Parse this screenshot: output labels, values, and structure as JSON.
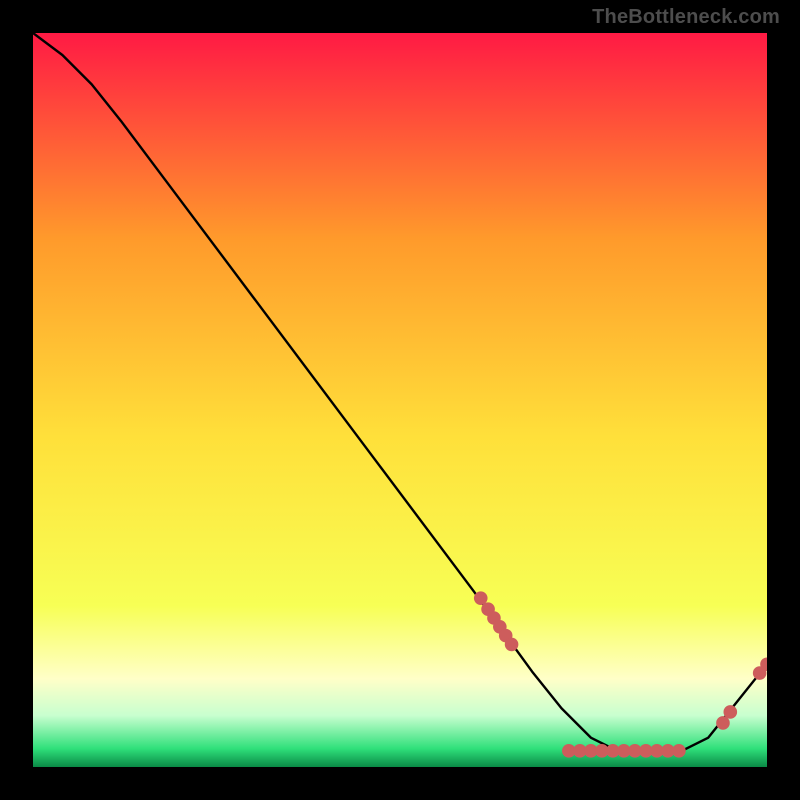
{
  "watermark": "TheBottleneck.com",
  "colors": {
    "frame": "#000000",
    "line": "#000000",
    "point": "#cd5d5c",
    "gradient_top": "#ff1a44",
    "gradient_upper_mid": "#ff9a2b",
    "gradient_mid": "#ffe03a",
    "gradient_lower_mid": "#f7ff55",
    "gradient_yellowwhite": "#ffffc8",
    "gradient_pale": "#c8ffcf",
    "gradient_green": "#2fe07a",
    "gradient_dark_green": "#0a8a46"
  },
  "chart_data": {
    "type": "line",
    "title": "",
    "xlabel": "",
    "ylabel": "",
    "xlim": [
      0,
      100
    ],
    "ylim": [
      0,
      100
    ],
    "grid": false,
    "legend": false,
    "series": [
      {
        "name": "curve",
        "x": [
          0,
          4,
          8,
          12,
          18,
          30,
          45,
          60,
          68,
          72,
          76,
          80,
          84,
          88,
          92,
          96,
          100
        ],
        "y": [
          100,
          97,
          93,
          88,
          80,
          64,
          44,
          24,
          13,
          8,
          4,
          2,
          2,
          2,
          4,
          9,
          14
        ]
      }
    ],
    "scatter_points": [
      {
        "x": 61,
        "y": 23.0
      },
      {
        "x": 62,
        "y": 21.5
      },
      {
        "x": 62.8,
        "y": 20.3
      },
      {
        "x": 63.6,
        "y": 19.1
      },
      {
        "x": 64.4,
        "y": 17.9
      },
      {
        "x": 65.2,
        "y": 16.7
      },
      {
        "x": 73,
        "y": 2.2
      },
      {
        "x": 74.5,
        "y": 2.2
      },
      {
        "x": 76,
        "y": 2.2
      },
      {
        "x": 77.5,
        "y": 2.2
      },
      {
        "x": 79,
        "y": 2.2
      },
      {
        "x": 80.5,
        "y": 2.2
      },
      {
        "x": 82,
        "y": 2.2
      },
      {
        "x": 83.5,
        "y": 2.2
      },
      {
        "x": 85,
        "y": 2.2
      },
      {
        "x": 86.5,
        "y": 2.2
      },
      {
        "x": 88,
        "y": 2.2
      },
      {
        "x": 94,
        "y": 6.0
      },
      {
        "x": 95,
        "y": 7.5
      },
      {
        "x": 99,
        "y": 12.8
      },
      {
        "x": 100,
        "y": 14.0
      }
    ],
    "comment": "y estimated visually as percent of plot height; curve descends from top-left, flattens near bottom around x≈75–88, then rises at the right edge; scatter points cluster on the lower-right portion of the curve."
  }
}
